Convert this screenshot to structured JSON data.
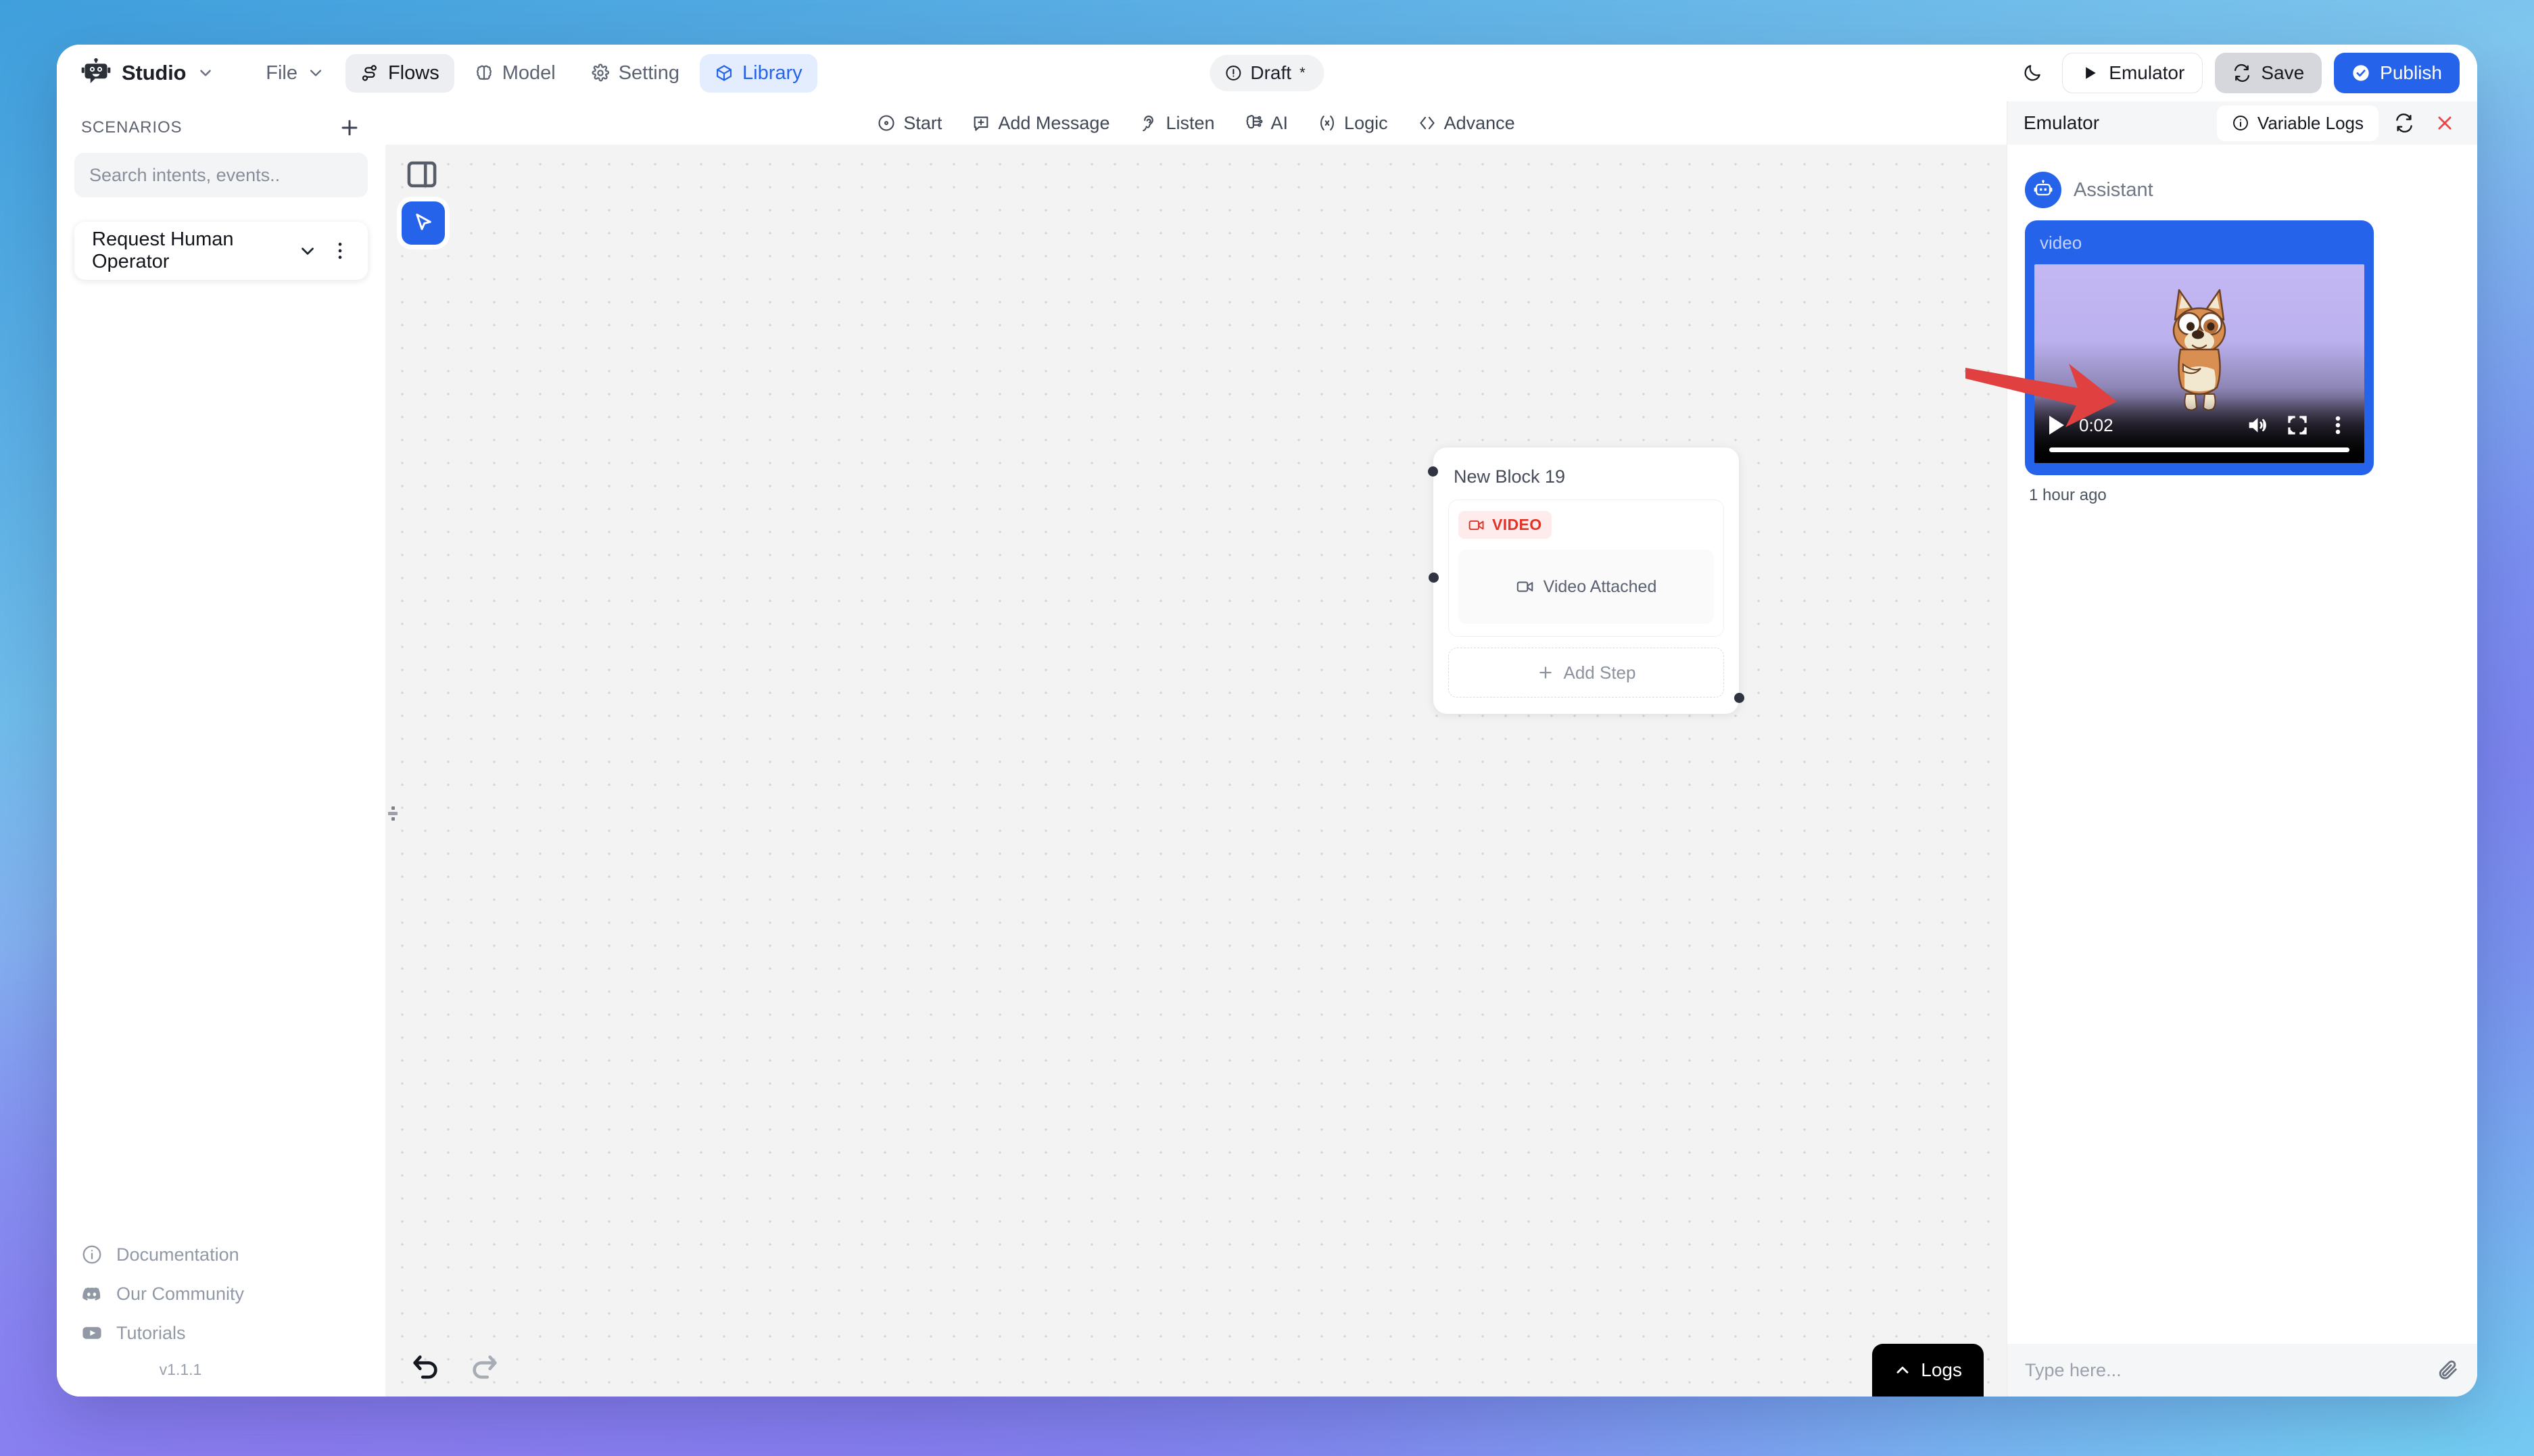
{
  "theme": {
    "accent": "#2563eb",
    "danger": "#e0342a",
    "bg_gradient_from": "#3f9fdc",
    "bg_gradient_to": "#8b7cf1",
    "annotation_arrow": "#e04040"
  },
  "topbar": {
    "brand": "Studio",
    "brand_icon": "robot-icon",
    "brand_caret_icon": "chevron-down-icon",
    "menu": [
      {
        "label": "File",
        "icon": "chevron-down-icon",
        "state": "default"
      },
      {
        "label": "Flows",
        "icon": "flow-icon",
        "state": "active-grey"
      },
      {
        "label": "Model",
        "icon": "brain-icon",
        "state": "default"
      },
      {
        "label": "Setting",
        "icon": "gear-icon",
        "state": "default"
      },
      {
        "label": "Library",
        "icon": "cube-icon",
        "state": "active-blue"
      }
    ],
    "status": {
      "label": "Draft",
      "marker": "*",
      "icon": "alert-circle-icon"
    },
    "dark_mode_icon": "moon-icon",
    "emulator_button": {
      "label": "Emulator",
      "icon": "play-icon"
    },
    "save_button": {
      "label": "Save",
      "icon": "sync-icon"
    },
    "publish_button": {
      "label": "Publish",
      "icon": "check-circle-icon"
    }
  },
  "sidebar": {
    "section_title": "SCENARIOS",
    "add_icon": "plus-icon",
    "search": {
      "value": "",
      "placeholder": "Search intents, events.."
    },
    "scenarios": [
      {
        "label": "Request Human Operator",
        "expand_icon": "chevron-down-icon",
        "menu_icon": "more-vertical-icon"
      }
    ],
    "links": [
      {
        "label": "Documentation",
        "icon": "info-circle-icon"
      },
      {
        "label": "Our Community",
        "icon": "discord-icon"
      },
      {
        "label": "Tutorials",
        "icon": "youtube-icon"
      }
    ],
    "version": "v1.1.1"
  },
  "canvas": {
    "toolbar": [
      {
        "label": "Start",
        "icon": "start-circle-icon"
      },
      {
        "label": "Add Message",
        "icon": "message-plus-icon"
      },
      {
        "label": "Listen",
        "icon": "ear-icon"
      },
      {
        "label": "AI",
        "icon": "ai-brain-icon"
      },
      {
        "label": "Logic",
        "icon": "logic-x-icon"
      },
      {
        "label": "Advance",
        "icon": "code-brackets-icon"
      }
    ],
    "panel_toggle_icon": "sidebar-toggle-icon",
    "cursor_tool_icon": "cursor-pointer-icon",
    "resize_handle_icon": "drag-handle-icon",
    "block": {
      "title": "New Block 19",
      "badge": {
        "label": "VIDEO",
        "icon": "video-camera-icon"
      },
      "media": {
        "label": "Video Attached",
        "icon": "video-camera-icon"
      },
      "add_step": {
        "label": "Add Step",
        "icon": "plus-icon"
      }
    },
    "undo_icon": "undo-arrow-icon",
    "redo_icon": "redo-arrow-icon",
    "logs_button": {
      "label": "Logs",
      "icon": "chevron-up-icon"
    }
  },
  "emulator": {
    "title": "Emulator",
    "variable_logs": {
      "label": "Variable Logs",
      "icon": "info-circle-icon"
    },
    "refresh_icon": "refresh-icon",
    "close_icon": "close-x-icon",
    "messages": [
      {
        "author": "Assistant",
        "avatar_icon": "robot-icon",
        "attachment_label": "video",
        "video": {
          "current_time": "0:02",
          "play_icon": "play-icon",
          "mute_icon": "volume-icon",
          "fullscreen_icon": "fullscreen-icon",
          "more_icon": "more-vertical-icon",
          "progress_percent": 100
        },
        "timestamp": "1 hour ago"
      }
    ],
    "input": {
      "value": "",
      "placeholder": "Type here..."
    },
    "attach_icon": "paperclip-icon"
  }
}
